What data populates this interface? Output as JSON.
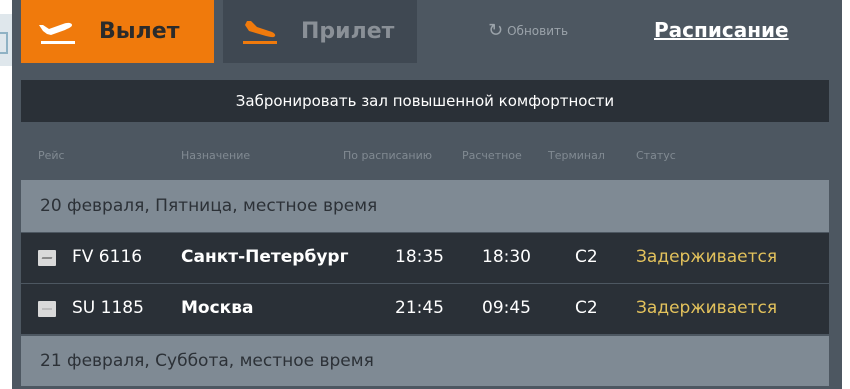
{
  "tabs": {
    "departures": "Вылет",
    "arrivals": "Прилет"
  },
  "refresh_label": "Обновить",
  "schedule_link": "Расписание",
  "banner": "Забронировать зал повышенной комфортности",
  "columns": {
    "flight": "Рейс",
    "destination": "Назначение",
    "scheduled": "По расписанию",
    "estimated": "Расчетное",
    "terminal": "Терминал",
    "status": "Статус"
  },
  "groups": [
    {
      "date": "20 февраля, Пятница, местное время",
      "flights": [
        {
          "flight": "FV 6116",
          "destination": "Санкт-Петербург",
          "scheduled": "18:35",
          "estimated": "18:30",
          "terminal": "C2",
          "status": "Задерживается"
        },
        {
          "flight": "SU 1185",
          "destination": "Москва",
          "scheduled": "21:45",
          "estimated": "09:45",
          "terminal": "C2",
          "status": "Задерживается"
        }
      ]
    },
    {
      "date": "21 февраля, Суббота, местное время",
      "flights": []
    }
  ],
  "colors": {
    "accent": "#f07a0c",
    "status_delayed": "#e3c25c",
    "panel": "#4d5761"
  }
}
